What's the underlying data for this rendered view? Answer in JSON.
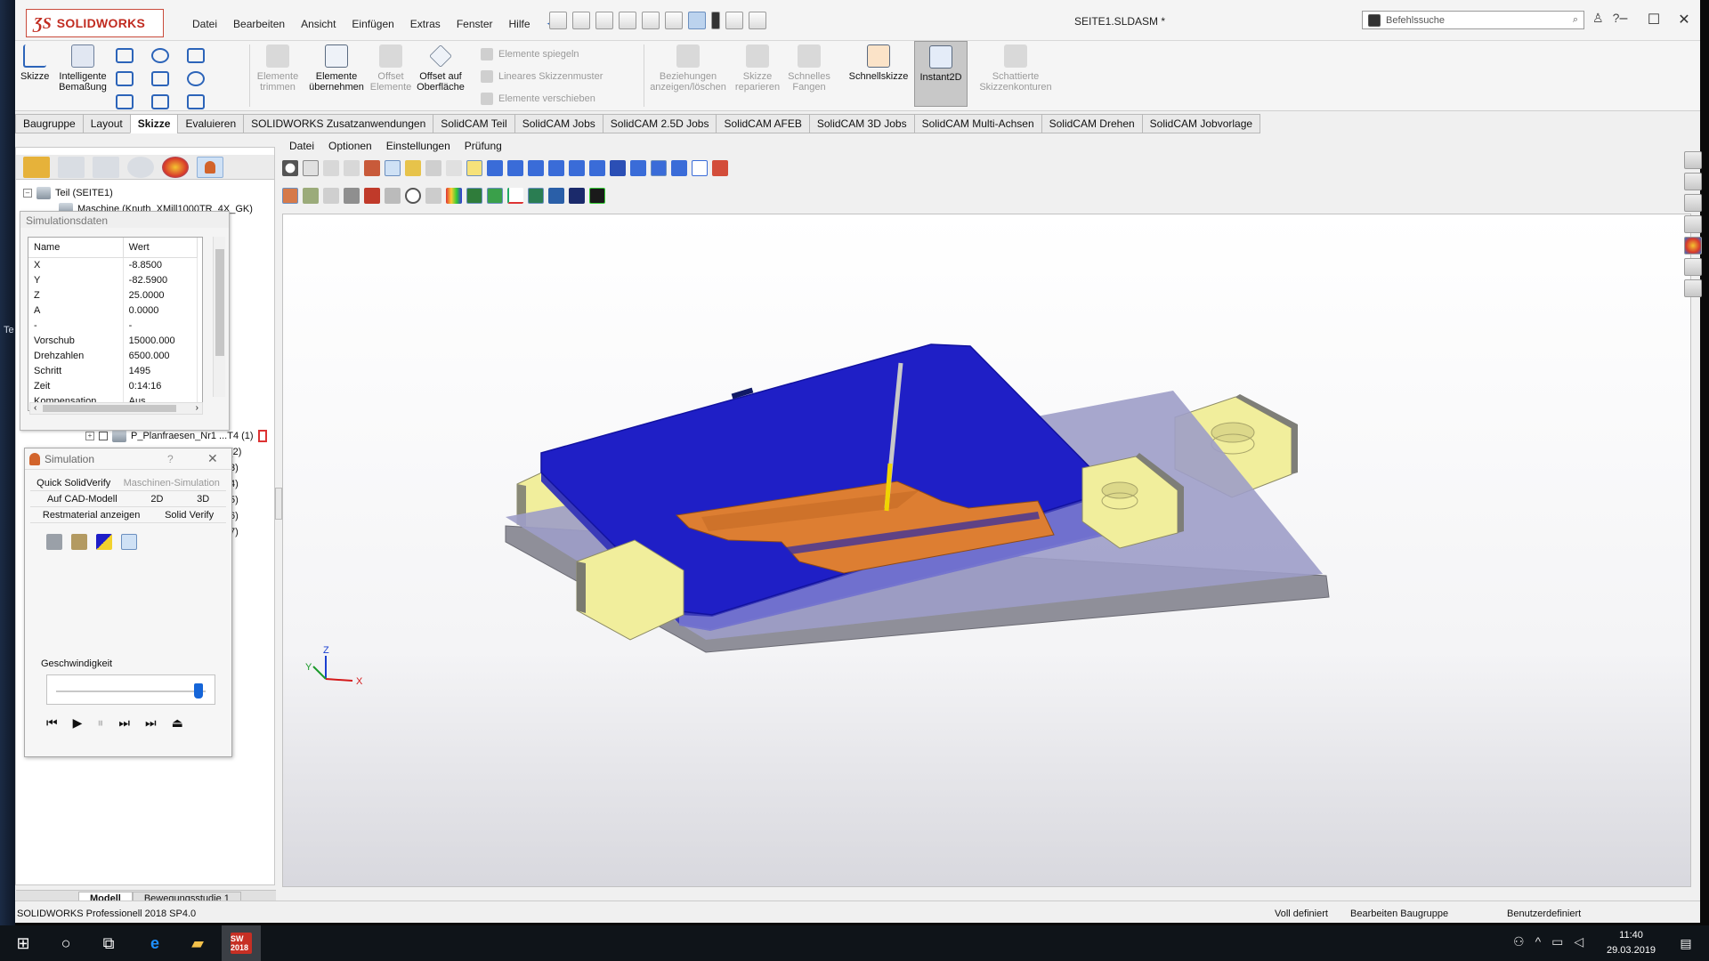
{
  "app": {
    "brand": "SOLIDWORKS",
    "document_title": "SEITE1.SLDASM *",
    "search_placeholder": "Befehlssuche",
    "menu": [
      "Datei",
      "Bearbeiten",
      "Ansicht",
      "Einfügen",
      "Extras",
      "Fenster",
      "Hilfe"
    ],
    "desktop_edge_text": "Te"
  },
  "ribbon": {
    "skizze": "Skizze",
    "smart_dim": "Intelligente Bemaßung",
    "trim": "Elemente trimmen",
    "convert": "Elemente übernehmen",
    "offset": "Offset Elemente",
    "offset_surface": "Offset auf Oberfläche",
    "mirror": "Elemente spiegeln",
    "linear_pattern": "Lineares Skizzenmuster",
    "move": "Elemente verschieben",
    "relations": "Beziehungen anzeigen/löschen",
    "repair": "Skizze reparieren",
    "quick_snaps": "Schnelles Fangen",
    "rapid_sketch": "Schnellskizze",
    "instant2d": "Instant2D",
    "shaded_contours": "Schattierte Skizzenkonturen"
  },
  "tabs": [
    "Baugruppe",
    "Layout",
    "Skizze",
    "Evaluieren",
    "SOLIDWORKS Zusatzanwendungen",
    "SolidCAM Teil",
    "SolidCAM Jobs",
    "SolidCAM 2.5D Jobs",
    "SolidCAM AFEB",
    "SolidCAM 3D Jobs",
    "SolidCAM Multi-Achsen",
    "SolidCAM Drehen",
    "SolidCAM Jobvorlage"
  ],
  "active_tab": "Skizze",
  "tree": {
    "root": "Teil (SEITE1)",
    "machine": "Maschine (Knuth_XMill1000TR_4X_GK)",
    "operation": "P_Planfraesen_Nr1 ...T4 (1)",
    "partial_labels": [
      "(2)",
      "3)",
      "4)",
      "5)",
      "6)",
      "7)"
    ]
  },
  "simdata": {
    "title": "Simulationsdaten",
    "col_name": "Name",
    "col_value": "Wert",
    "rows": [
      {
        "name": "X",
        "value": "-8.8500"
      },
      {
        "name": "Y",
        "value": "-82.5900"
      },
      {
        "name": "Z",
        "value": "25.0000"
      },
      {
        "name": "A",
        "value": "0.0000"
      },
      {
        "name": "-",
        "value": "-"
      },
      {
        "name": "Vorschub",
        "value": "15000.000"
      },
      {
        "name": "Drehzahlen",
        "value": "6500.000"
      },
      {
        "name": "Schritt",
        "value": "1495"
      },
      {
        "name": "Zeit",
        "value": "0:14:16"
      },
      {
        "name": "Kompensation",
        "value": "Aus"
      }
    ]
  },
  "simulation": {
    "title": "Simulation",
    "help": "?",
    "close": "✕",
    "tab_quick": "Quick SolidVerify",
    "tab_machine": "Maschinen-Simulation",
    "tab_cad": "Auf CAD-Modell",
    "tab_2d": "2D",
    "tab_3d": "3D",
    "tab_rest": "Restmaterial anzeigen",
    "tab_solid": "Solid Verify",
    "speed_label": "Geschwindigkeit",
    "speed_value": 0.95
  },
  "viewport_menu": [
    "Datei",
    "Optionen",
    "Einstellungen",
    "Prüfung"
  ],
  "bottom_tabs": {
    "model": "Modell",
    "motion": "Bewegungsstudie 1"
  },
  "status": {
    "product": "SOLIDWORKS Professionell 2018 SP4.0",
    "defined": "Voll definiert",
    "editing": "Bearbeiten Baugruppe",
    "units": "Benutzerdefiniert"
  },
  "triad": {
    "x": "X",
    "y": "Y",
    "z": "Z"
  },
  "taskbar": {
    "time": "11:40",
    "date": "29.03.2019",
    "sw_label": "SW 2018"
  },
  "colors": {
    "brand_red": "#c12c21",
    "stock_blue": "#1e1ec8",
    "part_orange": "#d8782e",
    "clamp_yellow": "#f2ef9a",
    "fixture_gray": "#7a7a88"
  }
}
